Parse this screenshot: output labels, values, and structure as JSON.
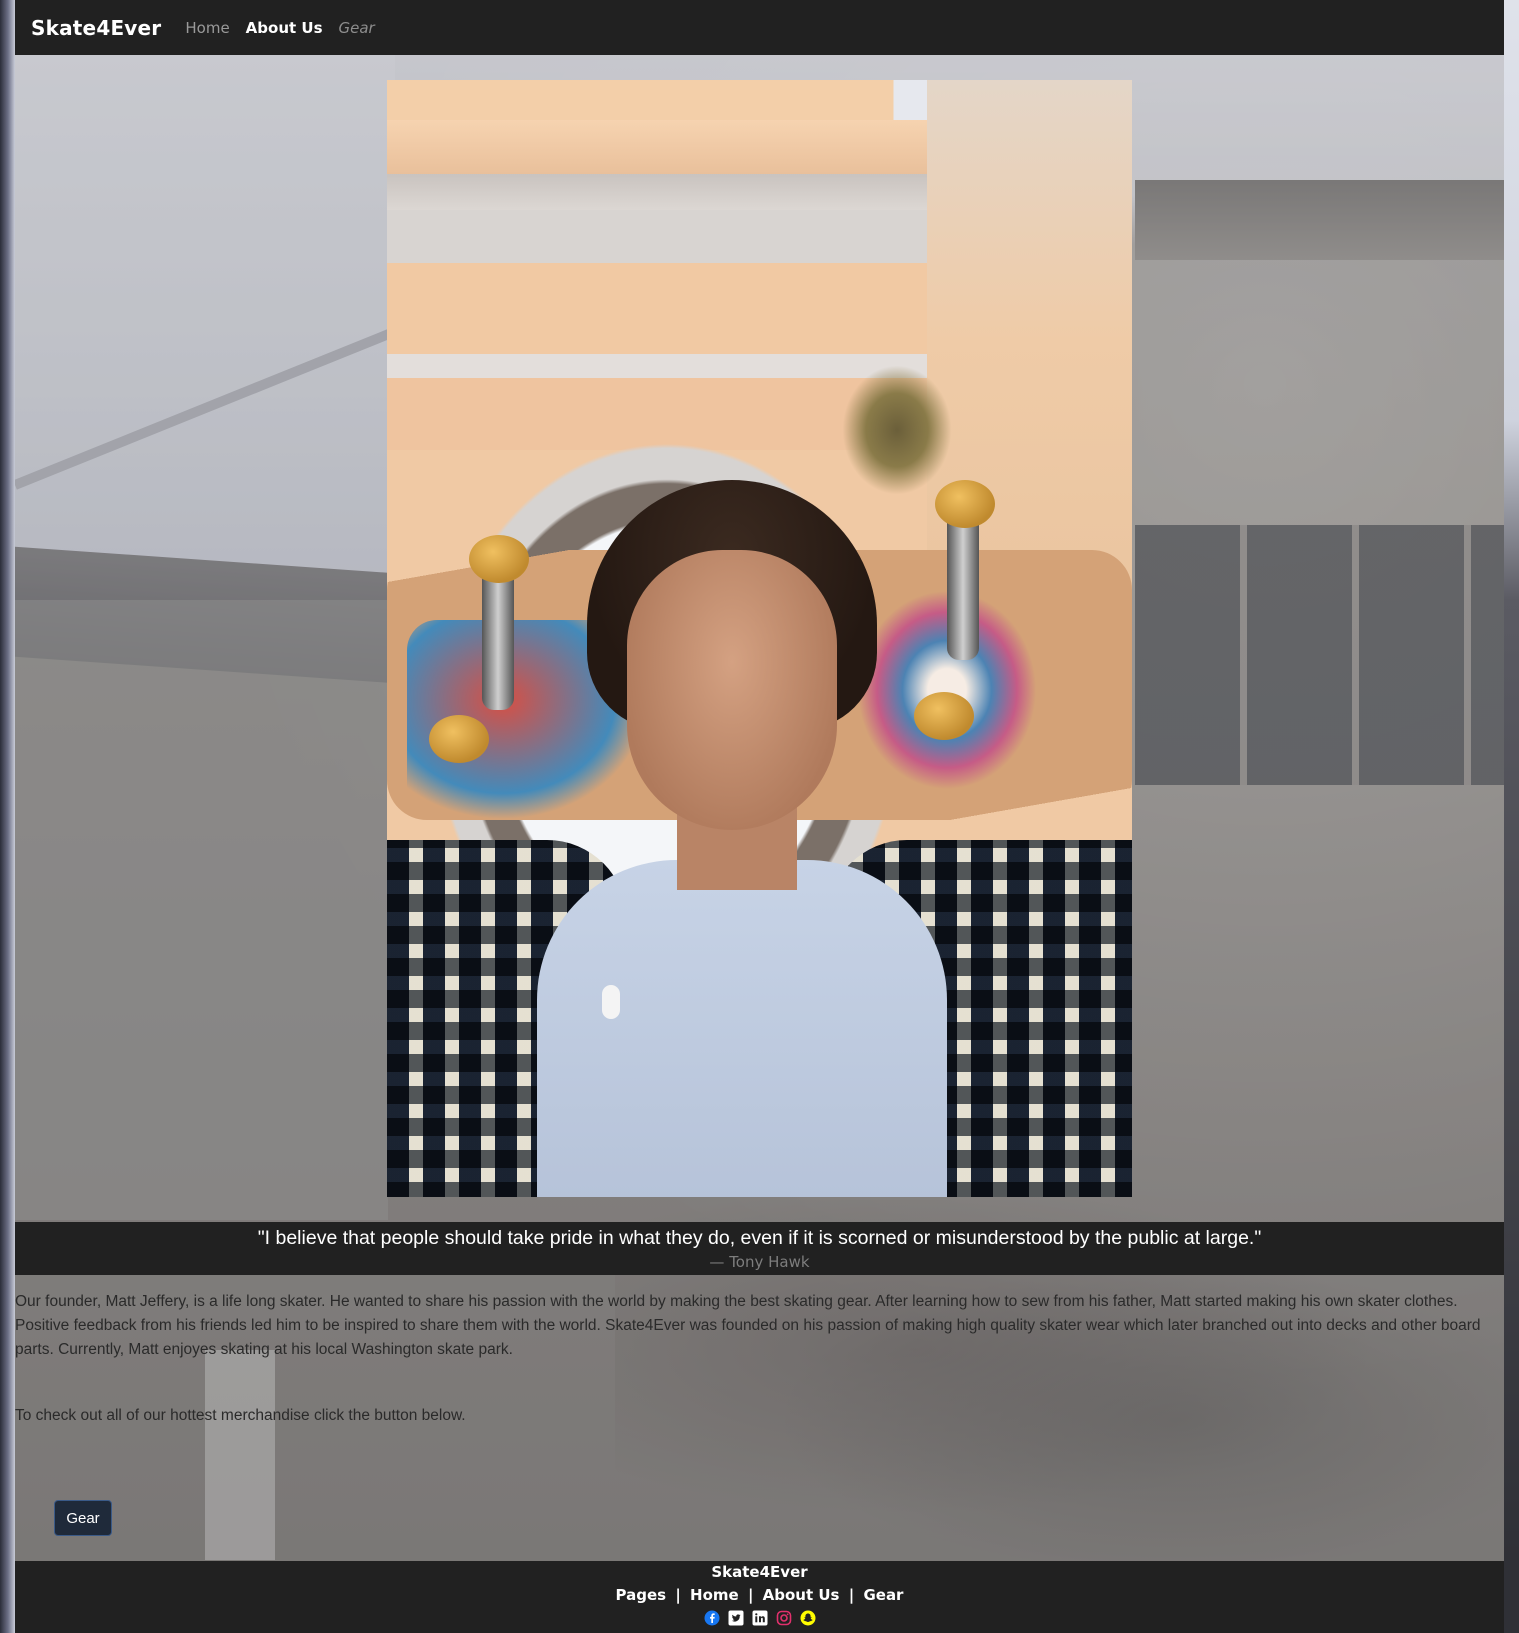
{
  "navbar": {
    "brand": "Skate4Ever",
    "links": [
      {
        "label": "Home",
        "state": "inactive"
      },
      {
        "label": "About Us",
        "state": "active"
      },
      {
        "label": "Gear",
        "state": "inactive"
      }
    ]
  },
  "hero": {
    "image_alt_subject": "skater-holding-skateboard-photo"
  },
  "quote": {
    "text": "\"I believe that people should take pride in what they do, even if it is scorned or misunderstood by the public at large.\"",
    "author": "— Tony Hawk"
  },
  "about": {
    "paragraph": "Our founder, Matt Jeffery, is a life long skater. He wanted to share his passion with the world by making the best skating gear. After learning how to sew from his father, Matt started making his own skater clothes. Positive feedback from his friends led him to be inspired to share them with the world. Skate4Ever was founded on his passion of making high quality skater wear which later branched out into decks and other board parts. Currently, Matt enjoyes skating at his local Washington skate park.",
    "cta": "To check out all of our hottest merchandise click the button below.",
    "button_label": "Gear"
  },
  "footer": {
    "brand": "Skate4Ever",
    "links": [
      "Pages",
      "Home",
      "About Us",
      "Gear"
    ],
    "separator": "|",
    "socials": [
      {
        "icon": "facebook-icon",
        "color": "#1877f2"
      },
      {
        "icon": "twitter-icon",
        "color": "#ffffff"
      },
      {
        "icon": "linkedin-icon",
        "color": "#ffffff"
      },
      {
        "icon": "instagram-icon",
        "color": "#e1306c"
      },
      {
        "icon": "snapchat-icon",
        "color": "#fffc00"
      }
    ]
  },
  "colors": {
    "bar_background": "#212121",
    "button_background": "#1f2a3a"
  }
}
